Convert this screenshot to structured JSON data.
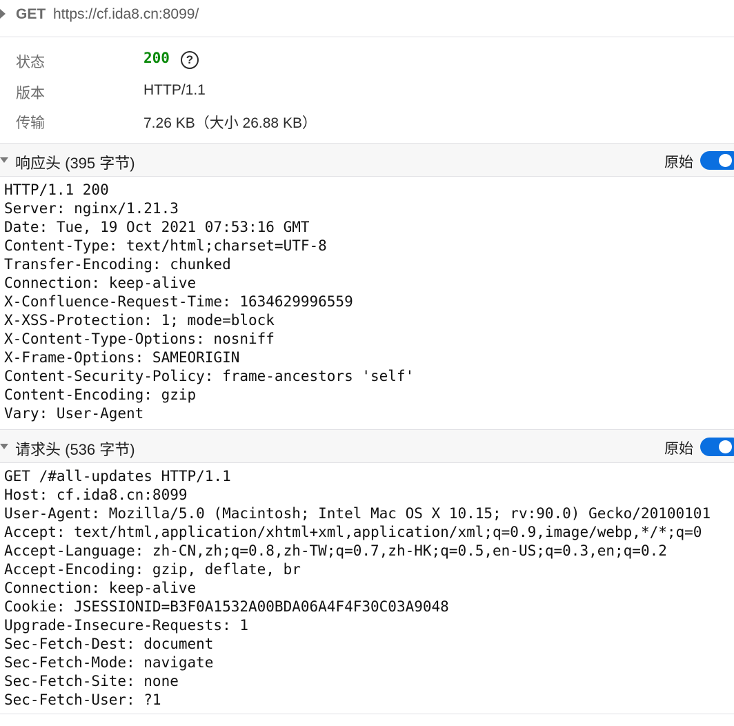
{
  "request": {
    "method": "GET",
    "url": "https://cf.ida8.cn:8099/"
  },
  "summary": {
    "status_label": "状态",
    "status_code": "200",
    "help_glyph": "?",
    "version_label": "版本",
    "version_value": "HTTP/1.1",
    "transfer_label": "传输",
    "transfer_value": "7.26 KB（大小 26.88 KB）"
  },
  "response_headers": {
    "title": "响应头 (395 字节)",
    "raw_label": "原始",
    "raw_enabled": true,
    "lines": [
      "HTTP/1.1 200",
      "Server: nginx/1.21.3",
      "Date: Tue, 19 Oct 2021 07:53:16 GMT",
      "Content-Type: text/html;charset=UTF-8",
      "Transfer-Encoding: chunked",
      "Connection: keep-alive",
      "X-Confluence-Request-Time: 1634629996559",
      "X-XSS-Protection: 1; mode=block",
      "X-Content-Type-Options: nosniff",
      "X-Frame-Options: SAMEORIGIN",
      "Content-Security-Policy: frame-ancestors 'self'",
      "Content-Encoding: gzip",
      "Vary: User-Agent"
    ]
  },
  "request_headers": {
    "title": "请求头 (536 字节)",
    "raw_label": "原始",
    "raw_enabled": true,
    "lines": [
      "GET /#all-updates HTTP/1.1",
      "Host: cf.ida8.cn:8099",
      "User-Agent: Mozilla/5.0 (Macintosh; Intel Mac OS X 10.15; rv:90.0) Gecko/20100101",
      "Accept: text/html,application/xhtml+xml,application/xml;q=0.9,image/webp,*/*;q=0",
      "Accept-Language: zh-CN,zh;q=0.8,zh-TW;q=0.7,zh-HK;q=0.5,en-US;q=0.3,en;q=0.2",
      "Accept-Encoding: gzip, deflate, br",
      "Connection: keep-alive",
      "Cookie: JSESSIONID=B3F0A1532A00BDA06A4F4F30C03A9048",
      "Upgrade-Insecure-Requests: 1",
      "Sec-Fetch-Dest: document",
      "Sec-Fetch-Mode: navigate",
      "Sec-Fetch-Site: none",
      "Sec-Fetch-User: ?1"
    ]
  },
  "colors": {
    "status_ok": "#0b8a0b",
    "toggle_on": "#0a6fe0"
  },
  "icons": {
    "expand": "chevron-right-icon",
    "collapse": "chevron-down-icon",
    "help": "help-circle-icon"
  }
}
